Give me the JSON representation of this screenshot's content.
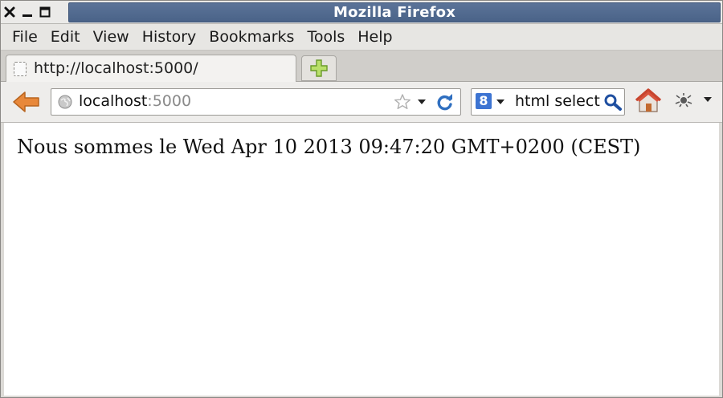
{
  "window": {
    "title": "Mozilla Firefox",
    "controls": [
      "close-icon",
      "minimize-icon",
      "maximize-icon"
    ]
  },
  "menubar": {
    "items": [
      {
        "label": "File"
      },
      {
        "label": "Edit"
      },
      {
        "label": "View"
      },
      {
        "label": "History"
      },
      {
        "label": "Bookmarks"
      },
      {
        "label": "Tools"
      },
      {
        "label": "Help"
      }
    ]
  },
  "tabs": [
    {
      "label": "http://localhost:5000/",
      "active": true
    }
  ],
  "navbar": {
    "url_host": "localhost",
    "url_port": ":5000",
    "search_engine_letter": "8",
    "search_value": "html select"
  },
  "page": {
    "text": "Nous sommes le Wed Apr 10 2013 09:47:20 GMT+0200 (CEST)"
  },
  "colors": {
    "titlebar": "#4f6890",
    "back_arrow": "#e8883a",
    "reload": "#2f6fc0",
    "home": "#d9533c",
    "search_engine": "#3d74d2"
  }
}
